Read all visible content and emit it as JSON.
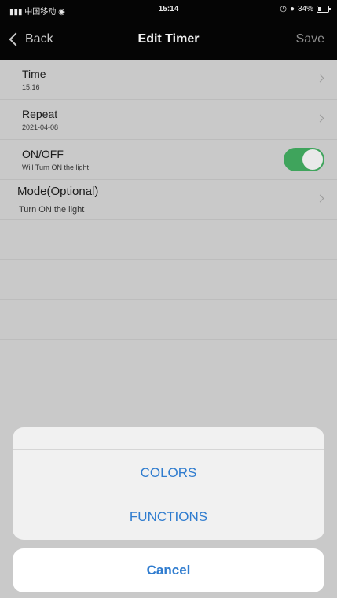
{
  "status_bar": {
    "carrier": "中国移动",
    "time": "15:14",
    "battery": "34%"
  },
  "nav": {
    "back_label": "Back",
    "title": "Edit Timer",
    "save_label": "Save"
  },
  "rows": {
    "time": {
      "title": "Time",
      "value": "15:16"
    },
    "repeat": {
      "title": "Repeat",
      "value": "2021-04-08"
    },
    "onoff": {
      "title": "ON/OFF",
      "value": "Will Turn ON the light",
      "enabled": true
    },
    "mode": {
      "title": "Mode(Optional)",
      "value": "Turn ON the light"
    }
  },
  "action_sheet": {
    "options": [
      "COLORS",
      "FUNCTIONS"
    ],
    "cancel_label": "Cancel"
  },
  "colors": {
    "toggle_on": "#3fa45c",
    "action_blue": "#2f7ccf"
  }
}
